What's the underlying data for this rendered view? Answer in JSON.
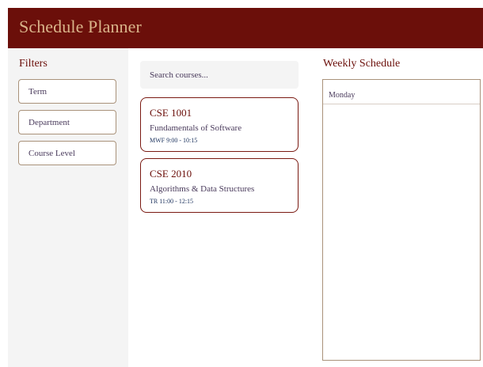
{
  "header": {
    "title": "Schedule Planner"
  },
  "filters": {
    "title": "Filters",
    "items": [
      {
        "label": "Term"
      },
      {
        "label": "Department"
      },
      {
        "label": "Course Level"
      }
    ]
  },
  "search": {
    "placeholder": "Search courses..."
  },
  "courses": [
    {
      "code": "CSE 1001",
      "name": "Fundamentals of Software",
      "time": "MWF 9:00 - 10:15"
    },
    {
      "code": "CSE 2010",
      "name": "Algorithms & Data Structures",
      "time": "TR 11:00 - 12:15"
    }
  ],
  "schedule": {
    "title": "Weekly Schedule",
    "days": [
      "Monday"
    ]
  },
  "colors": {
    "header_bg": "#6b0f0a",
    "header_text": "#d9b48a",
    "accent": "#6b0f0a",
    "panel_bg": "#f4f4f4"
  }
}
